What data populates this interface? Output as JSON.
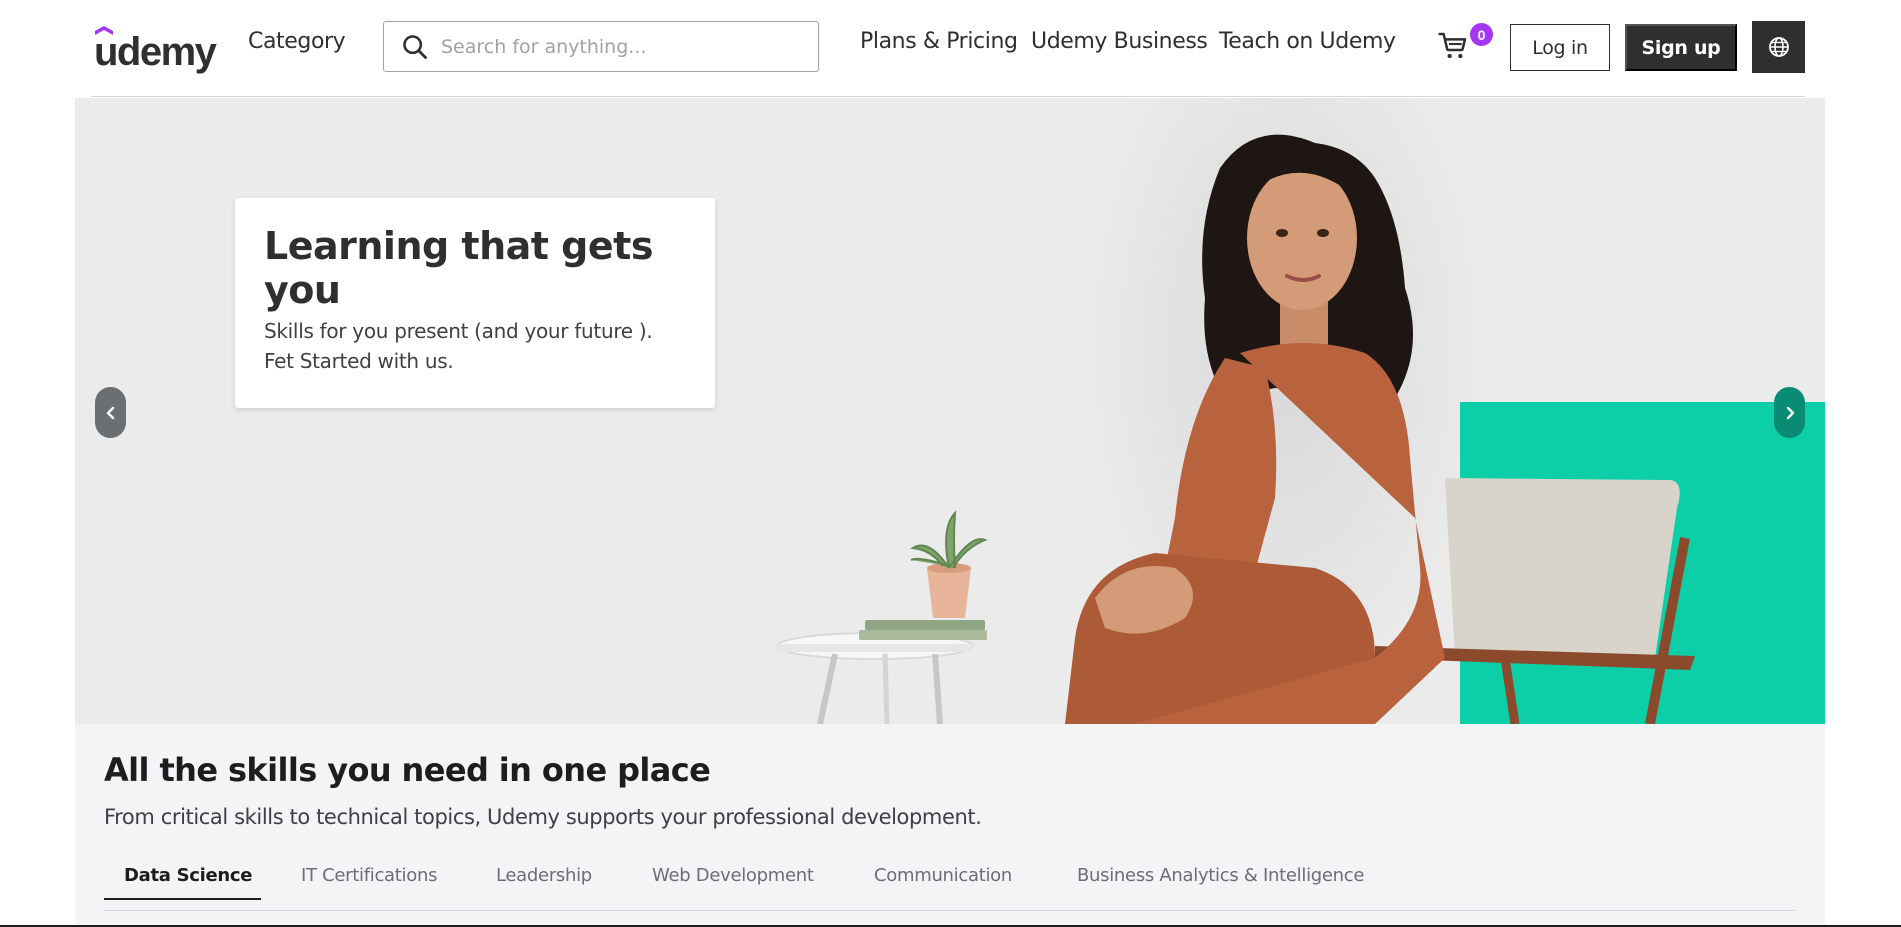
{
  "brand": {
    "logo_text": "udemy",
    "accent": "#a435f0",
    "teal": "#0ccfa8"
  },
  "header": {
    "category_label": "Category",
    "search": {
      "placeholder": "Search for anything...",
      "value": ""
    },
    "nav_links": [
      "Plans & Pricing",
      "Udemy Business",
      "Teach on Udemy"
    ],
    "cart_count": "0",
    "login_label": "Log in",
    "signup_label": "Sign up",
    "icons": {
      "search": "search-icon",
      "cart": "cart-icon",
      "language": "globe-icon"
    }
  },
  "hero": {
    "title": "Learning that gets you",
    "subtitle_line1": "Skills for you present (and your future ).",
    "subtitle_line2": "Fet Started with us.",
    "prev_icon": "chevron-left-icon",
    "next_icon": "chevron-right-icon"
  },
  "skills": {
    "title": "All the skills you need in one place",
    "subtitle": "From critical skills to technical topics, Udemy supports your professional development.",
    "tabs": [
      {
        "label": "Data Science",
        "active": true
      },
      {
        "label": "IT Certifications",
        "active": false
      },
      {
        "label": "Leadership",
        "active": false
      },
      {
        "label": "Web Development",
        "active": false
      },
      {
        "label": "Communication",
        "active": false
      },
      {
        "label": "Business Analytics & Intelligence",
        "active": false
      }
    ]
  }
}
